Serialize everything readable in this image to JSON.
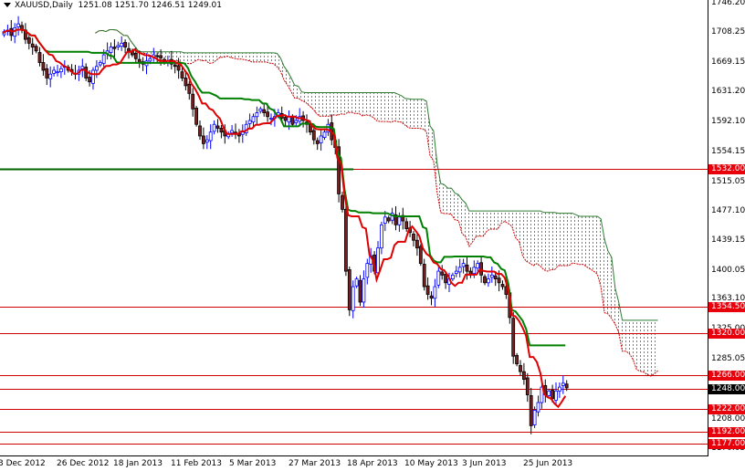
{
  "header": {
    "symbol": "XAUUSD,Daily",
    "ohlc": "1251.08 1251.70 1246.51 1249.01"
  },
  "colors": {
    "bull_outline": "#0000ff",
    "bear_body": "#8b1a1a",
    "tenkan": "#e00000",
    "kijun": "#006400",
    "level_line": "#cc0000",
    "support_line": "#006400",
    "cloud_dots": "#d2691e",
    "axis": "#000000"
  },
  "price_axis": {
    "ticks": [
      "1746.20",
      "1708.25",
      "1669.15",
      "1631.20",
      "1592.10",
      "1554.15",
      "1515.05",
      "1477.10",
      "1439.15",
      "1400.05",
      "1363.10",
      "1325.00",
      "1285.05",
      "1208.00",
      "1170.05"
    ]
  },
  "levels": [
    {
      "label": "1532.00",
      "value": 1532
    },
    {
      "label": "1354.50",
      "value": 1354.5
    },
    {
      "label": "1320.00",
      "value": 1320
    },
    {
      "label": "1266.00",
      "value": 1266
    },
    {
      "label": "1248.00",
      "value": 1248,
      "current": true
    },
    {
      "label": "1222.00",
      "value": 1222
    },
    {
      "label": "1192.00",
      "value": 1192
    },
    {
      "label": "1177.00",
      "value": 1177
    }
  ],
  "date_axis": {
    "labels": [
      "3 Dec 2012",
      "26 Dec 2012",
      "18 Jan 2013",
      "11 Feb 2013",
      "5 Mar 2013",
      "27 Mar 2013",
      "18 Apr 2013",
      "10 May 2013",
      "3 Jun 2013",
      "25 Jun 2013"
    ]
  },
  "closes": [
    1710,
    1712,
    1705,
    1715,
    1720,
    1712,
    1700,
    1695,
    1690,
    1685,
    1670,
    1660,
    1650,
    1655,
    1660,
    1658,
    1662,
    1665,
    1660,
    1658,
    1655,
    1660,
    1665,
    1650,
    1645,
    1660,
    1665,
    1670,
    1680,
    1685,
    1690,
    1688,
    1692,
    1695,
    1690,
    1685,
    1680,
    1675,
    1670,
    1668,
    1672,
    1675,
    1680,
    1678,
    1676,
    1670,
    1672,
    1668,
    1665,
    1660,
    1650,
    1640,
    1630,
    1610,
    1590,
    1575,
    1565,
    1570,
    1580,
    1590,
    1585,
    1580,
    1575,
    1578,
    1582,
    1578,
    1575,
    1580,
    1590,
    1595,
    1600,
    1605,
    1610,
    1605,
    1600,
    1598,
    1600,
    1605,
    1598,
    1595,
    1600,
    1590,
    1595,
    1600,
    1595,
    1590,
    1580,
    1570,
    1565,
    1575,
    1580,
    1590,
    1570,
    1560,
    1500,
    1480,
    1400,
    1350,
    1380,
    1390,
    1360,
    1390,
    1410,
    1420,
    1400,
    1430,
    1460,
    1470,
    1465,
    1475,
    1460,
    1470,
    1465,
    1455,
    1450,
    1440,
    1430,
    1410,
    1380,
    1370,
    1365,
    1380,
    1400,
    1395,
    1385,
    1390,
    1395,
    1400,
    1405,
    1410,
    1400,
    1395,
    1405,
    1410,
    1395,
    1385,
    1390,
    1395,
    1390,
    1385,
    1380,
    1370,
    1340,
    1290,
    1280,
    1270,
    1260,
    1240,
    1200,
    1220,
    1230,
    1250,
    1240,
    1245,
    1235,
    1245,
    1250,
    1255,
    1249
  ]
}
